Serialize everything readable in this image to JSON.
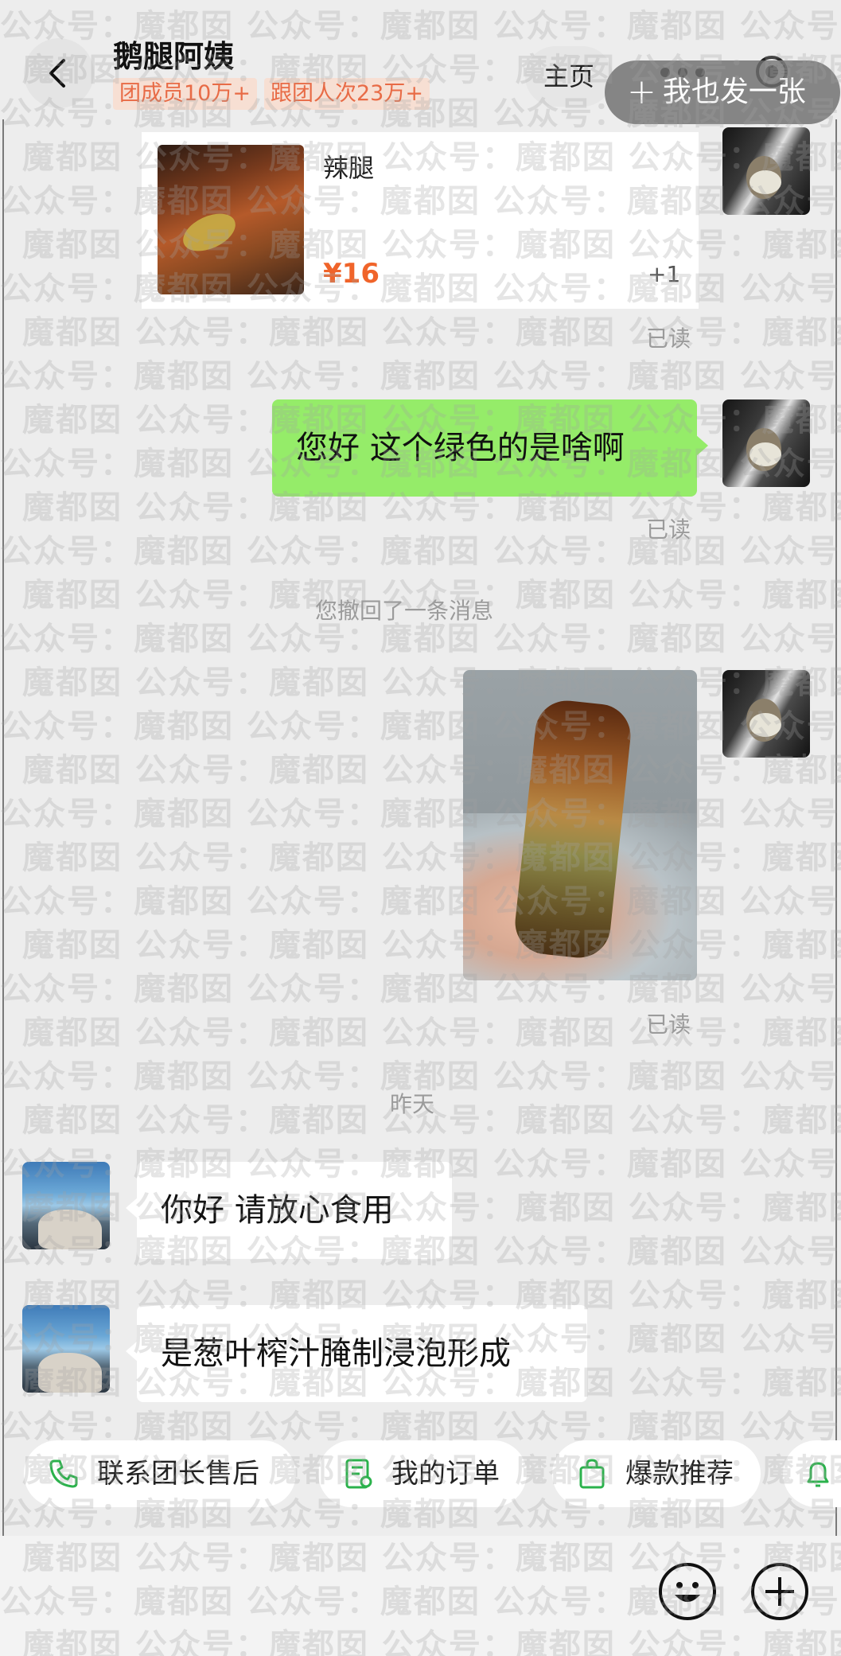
{
  "header": {
    "group_name": "鹅腿阿姨",
    "badge_members": "团成员10万+",
    "badge_visits": "跟团人次23万+",
    "home_label": "主页",
    "post_button_label": "我也发一张"
  },
  "watermark_text": "公众号：魔都囡 公众号：魔都囡 公众号：魔都囡 公众号：魔都囡",
  "product_card": {
    "title": "辣腿",
    "price": "¥16",
    "quantity": "+1"
  },
  "messages": {
    "read_label": "已读",
    "my_text": "您好 这个绿色的是啥啊",
    "recall_notice": "您撤回了一条消息",
    "day_separator": "昨天",
    "reply_1": "你好 请放心食用",
    "reply_2": "是葱叶榨汁腌制浸泡形成"
  },
  "quick_actions": [
    {
      "label": "联系团长售后",
      "icon": "phone-icon"
    },
    {
      "label": "我的订单",
      "icon": "order-icon"
    },
    {
      "label": "爆款推荐",
      "icon": "shopping-bag-icon"
    },
    {
      "label": "",
      "icon": "bell-icon"
    }
  ],
  "colors": {
    "accent_green": "#95ec69",
    "price_orange": "#f0642a",
    "badge_text": "#e86b46",
    "icon_green": "#2bb24c"
  }
}
